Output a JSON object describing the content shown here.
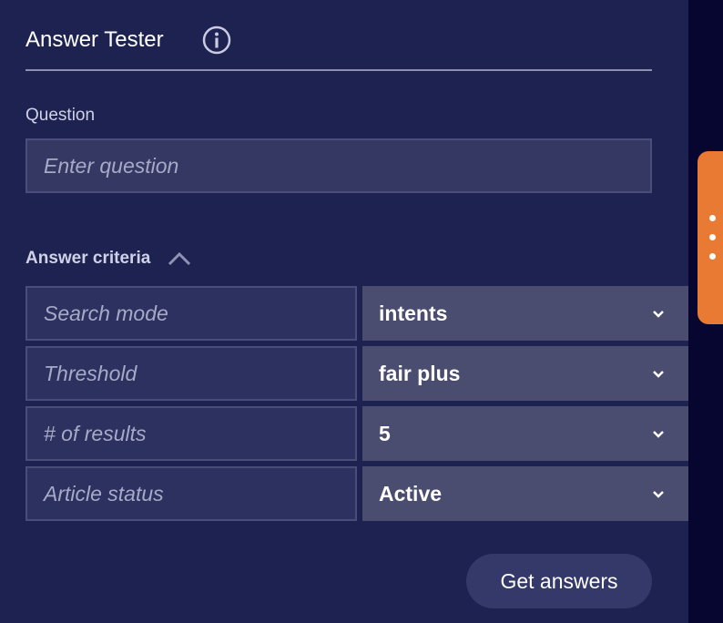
{
  "header": {
    "title": "Answer Tester"
  },
  "question": {
    "label": "Question",
    "placeholder": "Enter question",
    "value": ""
  },
  "criteria": {
    "label": "Answer criteria",
    "rows": [
      {
        "name": "Search mode",
        "value": "intents"
      },
      {
        "name": "Threshold",
        "value": "fair plus"
      },
      {
        "name": "# of results",
        "value": "5"
      },
      {
        "name": "Article status",
        "value": "Active"
      }
    ]
  },
  "actions": {
    "get_answers_label": "Get answers"
  },
  "colors": {
    "panel_bg": "#1e2250",
    "side_tab": "#e87a33",
    "select_bg": "#4a4d6f"
  },
  "icons": {
    "info": "info-icon",
    "collapse": "chevron-up-icon",
    "dropdown": "chevron-down-icon",
    "side_tab": "more-vertical-icon"
  }
}
